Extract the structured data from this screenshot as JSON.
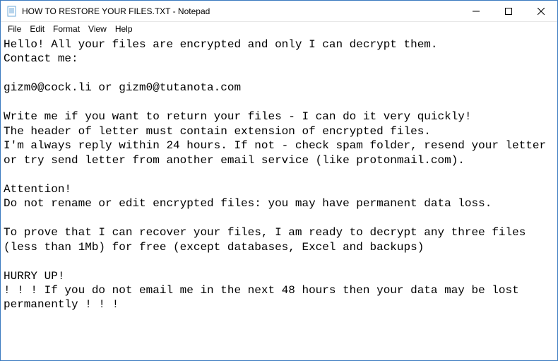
{
  "titlebar": {
    "title": "HOW TO RESTORE YOUR FILES.TXT - Notepad"
  },
  "menubar": {
    "file": "File",
    "edit": "Edit",
    "format": "Format",
    "view": "View",
    "help": "Help"
  },
  "content": {
    "text": "Hello! All your files are encrypted and only I can decrypt them.\nContact me:\n\ngizm0@cock.li or gizm0@tutanota.com\n\nWrite me if you want to return your files - I can do it very quickly!\nThe header of letter must contain extension of encrypted files.\nI'm always reply within 24 hours. If not - check spam folder, resend your letter or try send letter from another email service (like protonmail.com).\n\nAttention!\nDo not rename or edit encrypted files: you may have permanent data loss.\n\nTo prove that I can recover your files, I am ready to decrypt any three files (less than 1Mb) for free (except databases, Excel and backups)\n\nHURRY UP!\n! ! ! If you do not email me in the next 48 hours then your data may be lost permanently ! ! !"
  }
}
